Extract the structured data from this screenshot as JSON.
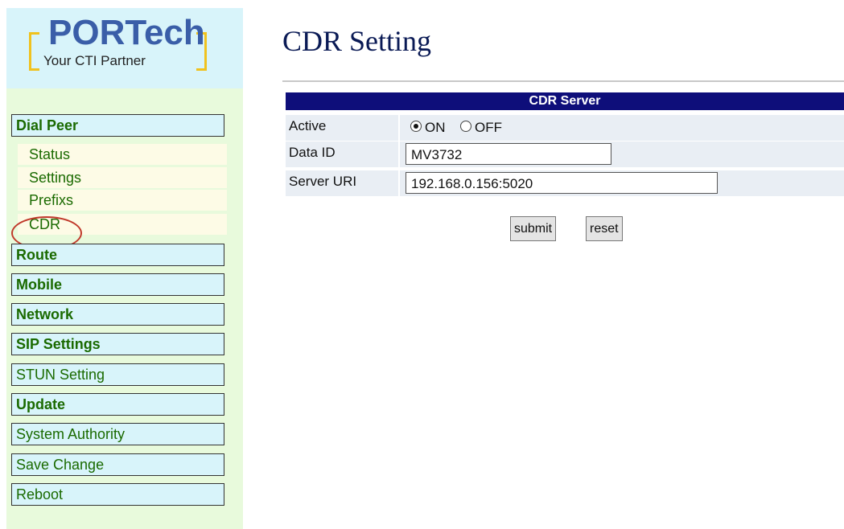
{
  "logo": {
    "main": "PORTech",
    "tagline": "Your CTI Partner"
  },
  "sidebar": {
    "items": [
      {
        "label": "Dial Peer",
        "style": "head-bold"
      },
      {
        "label": "Status",
        "style": "sub"
      },
      {
        "label": "Settings",
        "style": "sub"
      },
      {
        "label": "Prefixs",
        "style": "sub"
      },
      {
        "label": "CDR",
        "style": "sub",
        "highlighted": true
      },
      {
        "label": "Route",
        "style": "head-bold"
      },
      {
        "label": "Mobile",
        "style": "head-bold"
      },
      {
        "label": "Network",
        "style": "head-bold"
      },
      {
        "label": "SIP Settings",
        "style": "head-bold"
      },
      {
        "label": "STUN Setting",
        "style": "head-plain"
      },
      {
        "label": "Update",
        "style": "head-bold"
      },
      {
        "label": "System Authority",
        "style": "head-plain"
      },
      {
        "label": "Save Change",
        "style": "head-plain"
      },
      {
        "label": "Reboot",
        "style": "head-plain"
      }
    ]
  },
  "page": {
    "title": "CDR Setting"
  },
  "cdr_server": {
    "header": "CDR Server",
    "active": {
      "label": "Active",
      "options": [
        "ON",
        "OFF"
      ],
      "selected": "ON"
    },
    "data_id": {
      "label": "Data ID",
      "value": "MV3732"
    },
    "server_uri": {
      "label": "Server URI",
      "value": "192.168.0.156:5020"
    }
  },
  "buttons": {
    "submit": "submit",
    "reset": "reset"
  },
  "colors": {
    "header_bg": "#0e0e7a",
    "sidebar_bg": "#e8fadc",
    "logo_bg": "#d8f4fa",
    "highlight": "#c0392b"
  }
}
